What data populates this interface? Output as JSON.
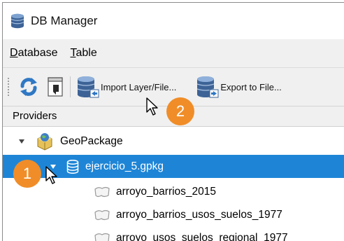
{
  "window": {
    "title": "DB Manager",
    "app_icon": "database-icon"
  },
  "menubar": {
    "items": [
      {
        "label_first": "D",
        "label_rest": "atabase"
      },
      {
        "label_first": "T",
        "label_rest": "able"
      }
    ]
  },
  "toolbar": {
    "refresh_icon": "refresh-icon",
    "sql_icon": "sql-window-icon",
    "import_label": "Import Layer/File...",
    "export_label": "Export to File..."
  },
  "providers": {
    "header": "Providers"
  },
  "tree": {
    "provider": {
      "label": "GeoPackage",
      "icon": "geopackage-icon"
    },
    "database": {
      "label": "ejercicio_5.gpkg",
      "icon": "database-icon"
    },
    "layers": [
      {
        "label": "arroyo_barrios_2015",
        "icon": "polygon-layer-icon"
      },
      {
        "label": "arroyo_barrios_usos_suelos_1977",
        "icon": "polygon-layer-icon"
      },
      {
        "label": "arroyo_usos_suelos_regional_1977",
        "icon": "polygon-layer-icon"
      }
    ]
  },
  "annotations": [
    {
      "number": "1",
      "color": "#f08d28"
    },
    {
      "number": "2",
      "color": "#f08d28"
    }
  ],
  "colors": {
    "selection": "#1e85d6",
    "badge": "#f08d28"
  }
}
